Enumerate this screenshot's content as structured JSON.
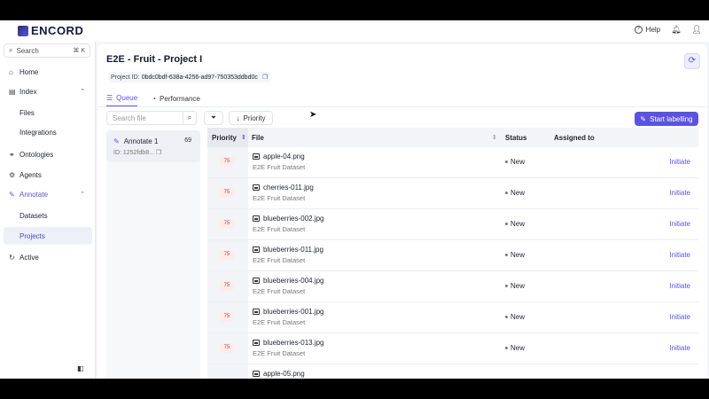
{
  "brand": {
    "name": "ENCORD"
  },
  "topbar": {
    "help_label": "Help"
  },
  "sidebar": {
    "search_placeholder": "Search",
    "search_shortcut": "⌘ K",
    "items": [
      {
        "label": "Home",
        "icon": "home-icon"
      },
      {
        "label": "Index",
        "icon": "index-icon"
      },
      {
        "label": "Files"
      },
      {
        "label": "Integrations"
      },
      {
        "label": "Ontologies",
        "icon": "ontology-icon"
      },
      {
        "label": "Agents",
        "icon": "agent-icon"
      },
      {
        "label": "Annotate",
        "icon": "annotate-icon"
      },
      {
        "label": "Datasets"
      },
      {
        "label": "Projects"
      },
      {
        "label": "Active",
        "icon": "active-icon"
      }
    ]
  },
  "project": {
    "title": "E2E - Fruit - Project I",
    "id_label": "Project ID:",
    "id_value": "0bdc0bdf-638a-4256-ad97-750353ddbd0c"
  },
  "tabs": [
    {
      "label": "Queue",
      "active": true
    },
    {
      "label": "Performance",
      "active": false
    }
  ],
  "toolbar": {
    "file_search_placeholder": "Search file",
    "priority_label": "Priority",
    "start_label": "Start labelling"
  },
  "task": {
    "name": "Annotate 1",
    "count": "69",
    "id": "ID: 1252fdb8..."
  },
  "table": {
    "headers": {
      "priority": "Priority",
      "file": "File",
      "status": "Status",
      "assigned": "Assigned to"
    },
    "rows": [
      {
        "priority": "75",
        "file": "apple-04.png",
        "dataset": "E2E Fruit Dataset",
        "status": "New",
        "action": "Initiate"
      },
      {
        "priority": "75",
        "file": "cherries-011.jpg",
        "dataset": "E2E Fruit Dataset",
        "status": "New",
        "action": "Initiate"
      },
      {
        "priority": "75",
        "file": "blueberries-002.jpg",
        "dataset": "E2E Fruit Dataset",
        "status": "New",
        "action": "Initiate"
      },
      {
        "priority": "75",
        "file": "blueberries-011.jpg",
        "dataset": "E2E Fruit Dataset",
        "status": "New",
        "action": "Initiate"
      },
      {
        "priority": "75",
        "file": "blueberries-004.jpg",
        "dataset": "E2E Fruit Dataset",
        "status": "New",
        "action": "Initiate"
      },
      {
        "priority": "75",
        "file": "blueberries-001.jpg",
        "dataset": "E2E Fruit Dataset",
        "status": "New",
        "action": "Initiate"
      },
      {
        "priority": "75",
        "file": "blueberries-013.jpg",
        "dataset": "E2E Fruit Dataset",
        "status": "New",
        "action": "Initiate"
      },
      {
        "priority": "",
        "file": "apple-05.png",
        "dataset": "",
        "status": "",
        "action": ""
      }
    ]
  },
  "colors": {
    "accent": "#5b53e0",
    "priority_badge": "#c43b3b"
  }
}
